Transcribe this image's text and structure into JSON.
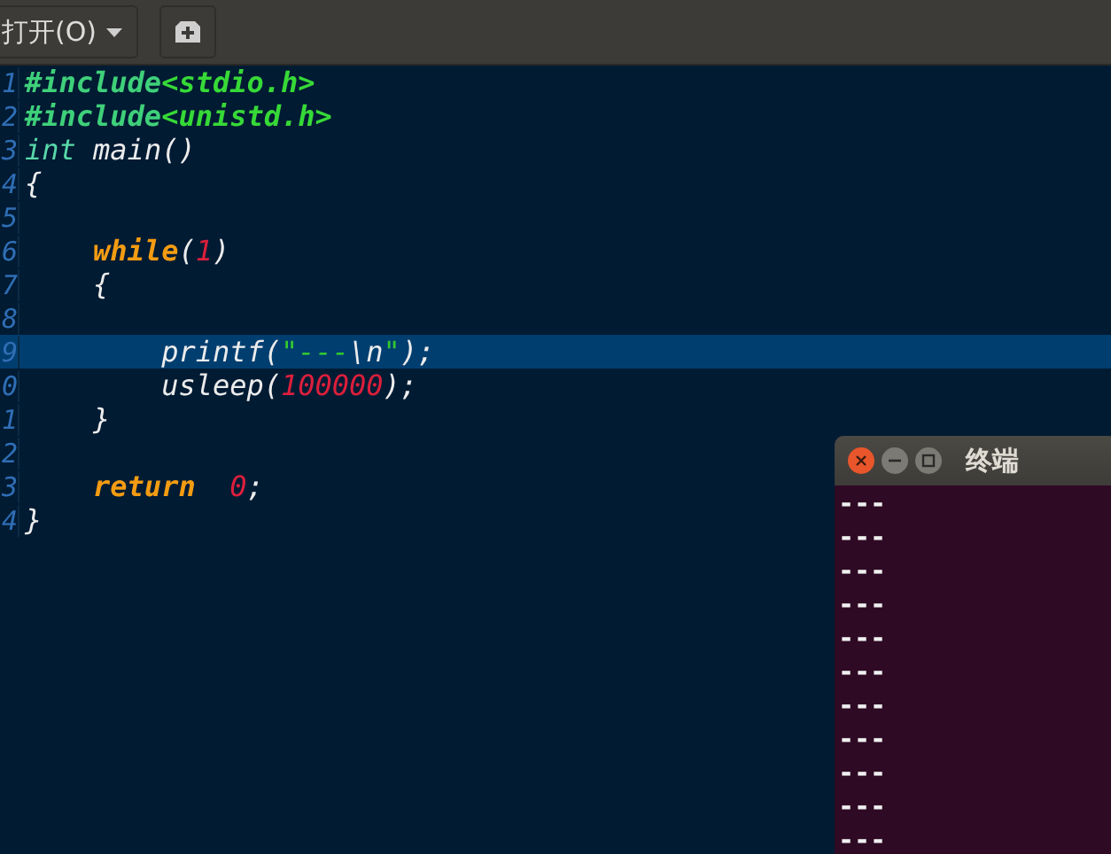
{
  "toolbar": {
    "open_button": {
      "label": "打开(O)"
    }
  },
  "editor": {
    "lines": [
      {
        "number": "1",
        "selected": false,
        "tokens": [
          {
            "text": "#include",
            "kind": "preproc"
          },
          {
            "text": "<stdio.h>",
            "kind": "header"
          }
        ]
      },
      {
        "number": "2",
        "selected": false,
        "tokens": [
          {
            "text": "#include",
            "kind": "preproc"
          },
          {
            "text": "<unistd.h>",
            "kind": "header"
          }
        ]
      },
      {
        "number": "3",
        "selected": false,
        "tokens": [
          {
            "text": "int",
            "kind": "type"
          },
          {
            "text": " main()",
            "kind": "plain"
          }
        ]
      },
      {
        "number": "4",
        "selected": false,
        "tokens": [
          {
            "text": "{",
            "kind": "plain"
          }
        ]
      },
      {
        "number": "5",
        "selected": false
      },
      {
        "number": "6",
        "selected": false,
        "tokens": [
          {
            "text": "    while",
            "kind": "keyword"
          },
          {
            "text": "(",
            "kind": "plain"
          },
          {
            "text": "1",
            "kind": "number"
          },
          {
            "text": ")",
            "kind": "plain"
          }
        ]
      },
      {
        "number": "7",
        "selected": false,
        "tokens": [
          {
            "text": "    {",
            "kind": "plain"
          }
        ]
      },
      {
        "number": "8",
        "selected": false
      },
      {
        "number": "9",
        "selected": true,
        "tokens": [
          {
            "text": "        printf(",
            "kind": "plain"
          },
          {
            "text": "\"---",
            "kind": "string"
          },
          {
            "text": "\\n",
            "kind": "plain"
          },
          {
            "text": "\"",
            "kind": "string"
          },
          {
            "text": ");",
            "kind": "plain"
          }
        ]
      },
      {
        "number": "0",
        "selected": false,
        "tokens": [
          {
            "text": "        usleep(",
            "kind": "plain"
          },
          {
            "text": "100000",
            "kind": "number"
          },
          {
            "text": ");",
            "kind": "plain"
          }
        ]
      },
      {
        "number": "1",
        "selected": false,
        "tokens": [
          {
            "text": "    }",
            "kind": "plain"
          }
        ]
      },
      {
        "number": "2",
        "selected": false
      },
      {
        "number": "3",
        "selected": false,
        "tokens": [
          {
            "text": "    return",
            "kind": "keyword"
          },
          {
            "text": "  0",
            "kind": "number"
          },
          {
            "text": ";",
            "kind": "plain"
          }
        ]
      },
      {
        "number": "4",
        "selected": false,
        "tokens": [
          {
            "text": "}",
            "kind": "plain"
          }
        ]
      }
    ]
  },
  "terminal": {
    "title": "终端",
    "output": [
      "---",
      "---",
      "---",
      "---",
      "---",
      "---",
      "---",
      "---",
      "---",
      "---",
      "---"
    ]
  }
}
